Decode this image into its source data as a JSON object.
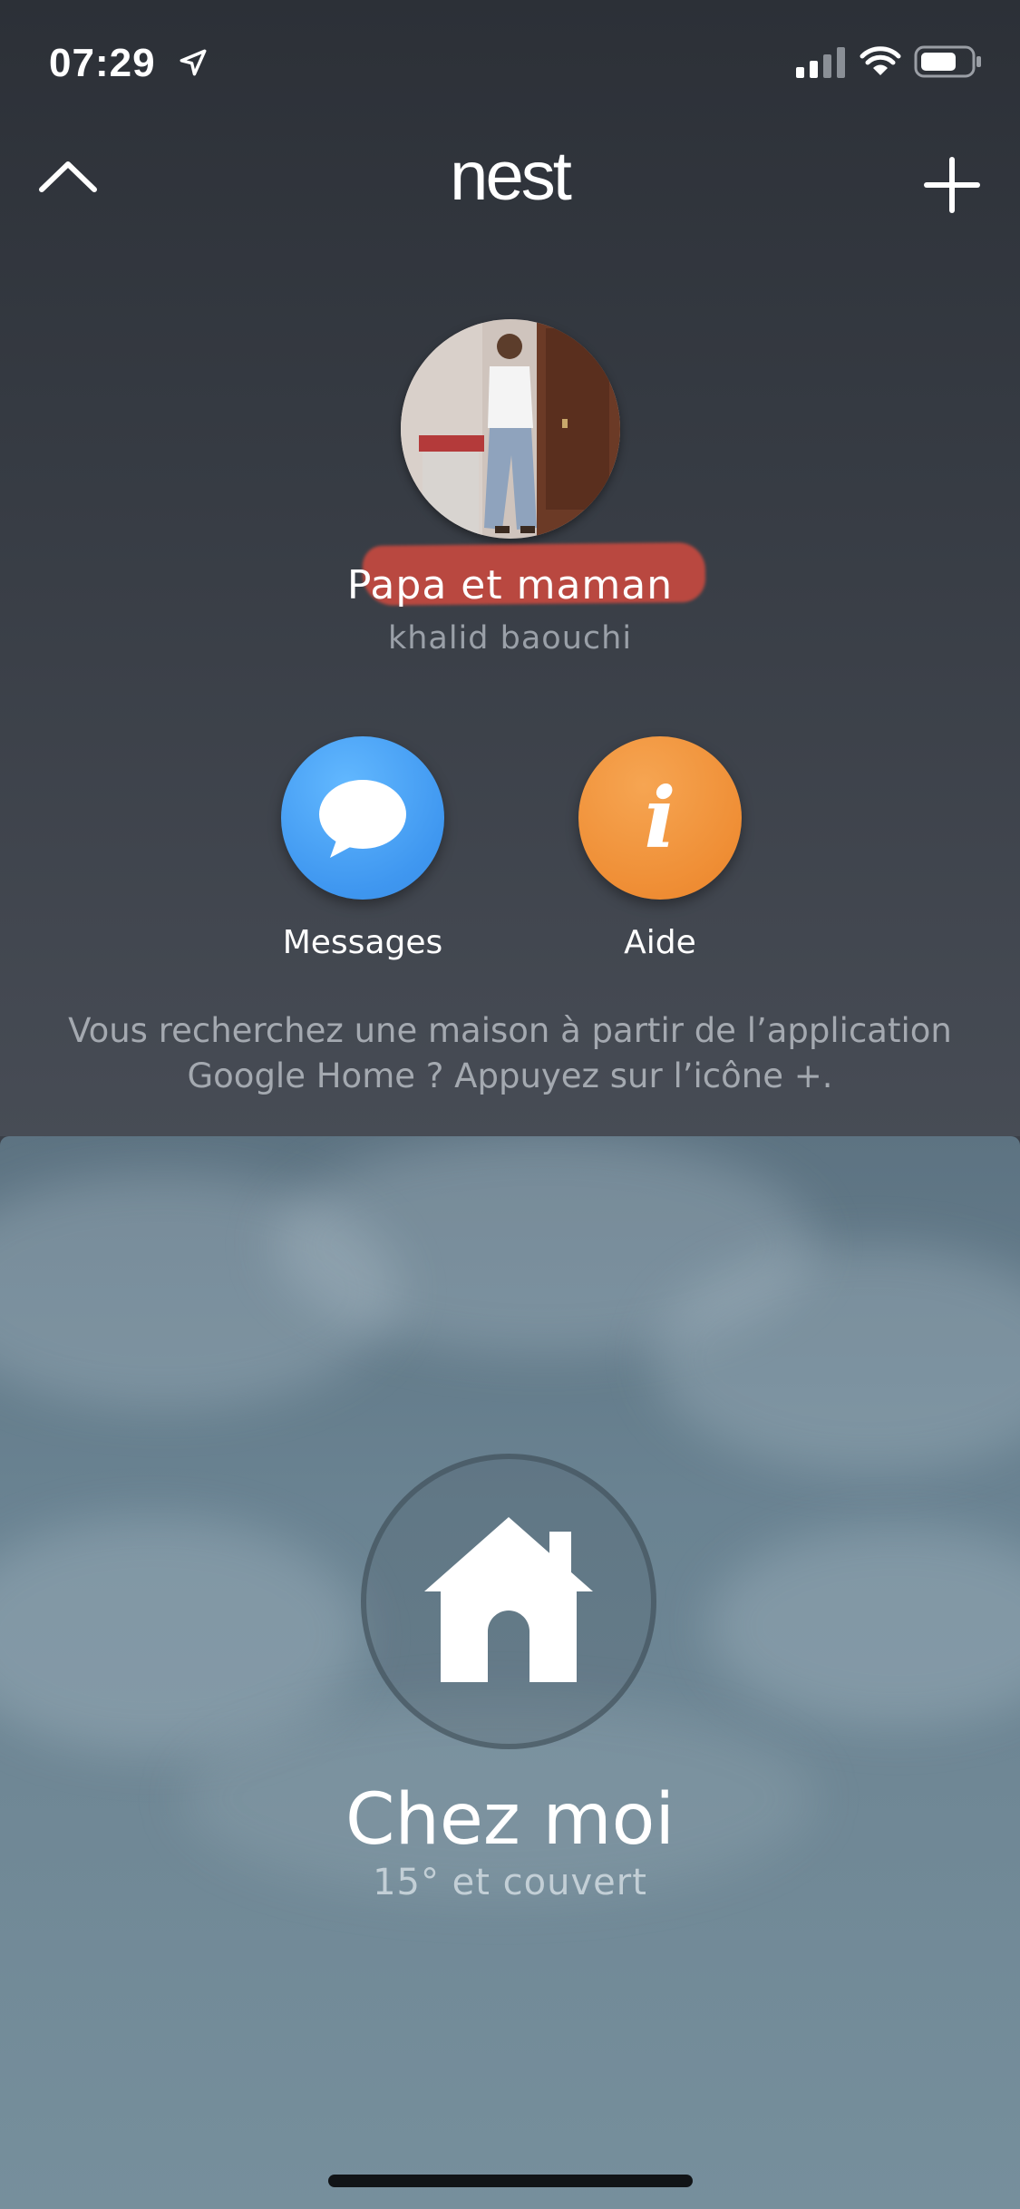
{
  "status_bar": {
    "time": "07:29",
    "icons": [
      "location-arrow-icon",
      "cellular-signal-icon",
      "wifi-icon",
      "battery-icon"
    ]
  },
  "header": {
    "logo_text": "nest",
    "left_icon": "chevron-up-icon",
    "right_icon": "plus-icon"
  },
  "profile": {
    "home_name": "Papa et maman",
    "owner": "khalid baouchi"
  },
  "actions": [
    {
      "label": "Messages",
      "icon": "chat-bubble-icon",
      "color": "#4aa3f7"
    },
    {
      "label": "Aide",
      "icon": "info-icon",
      "color": "#f09440"
    }
  ],
  "hint": {
    "text": "Vous recherchez une maison à partir de l’application Google Home ? Appuyez sur l’icône +."
  },
  "home": {
    "title": "Chez moi",
    "weather": "15° et couvert",
    "icon": "home-icon"
  },
  "colors": {
    "top_background": "#363b43",
    "panel_background": "#6f8795",
    "highlight": "#d64a3e"
  }
}
